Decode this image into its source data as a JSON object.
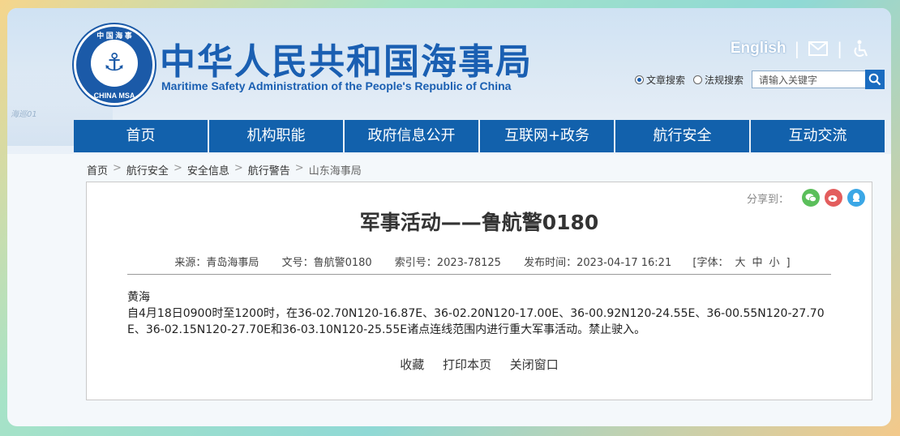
{
  "site": {
    "title_cn": "中华人民共和国海事局",
    "title_en": "Maritime Safety Administration of the People's Republic of China",
    "logo_top": "中 国 海 事",
    "logo_bottom": "CHINA MSA",
    "logo_symbol": "⚓",
    "ship_text": "海巡01"
  },
  "topbar": {
    "english_label": "English",
    "separator": "|",
    "mail_icon": "mail-icon",
    "accessibility_icon": "accessibility-icon"
  },
  "search": {
    "option_article": "文章搜索",
    "option_law": "法规搜索",
    "selected": "文章搜索",
    "placeholder": "请输入关键字"
  },
  "nav": {
    "items": [
      "首页",
      "机构职能",
      "政府信息公开",
      "互联网+政务",
      "航行安全",
      "互动交流"
    ]
  },
  "breadcrumb": {
    "items": [
      "首页",
      "航行安全",
      "安全信息",
      "航行警告",
      "山东海事局"
    ],
    "separator": ">"
  },
  "share": {
    "label": "分享到：",
    "icons": [
      "wechat-icon",
      "weibo-icon",
      "qq-icon"
    ],
    "colors": [
      "#5bbf5b",
      "#e35d5d",
      "#3ba7e6"
    ]
  },
  "article": {
    "title": "军事活动——鲁航警0180",
    "source": "来源：青岛海事局",
    "doc_no": "文号：鲁航警0180",
    "index_no": "索引号：2023-78125",
    "publish_time": "发布时间：2023-04-17 16:21",
    "font_label": "[字体：",
    "font_large": "大",
    "font_medium": "中",
    "font_small": "小",
    "font_end": "]",
    "area": "黄海",
    "content": "自4月18日0900时至1200时，在36-02.70N120-16.87E、36-02.20N120-17.00E、36-00.92N120-24.55E、36-00.55N120-27.70E、36-02.15N120-27.70E和36-03.10N120-25.55E诸点连线范围内进行重大军事活动。禁止驶入。"
  },
  "actions": {
    "favorite": "收藏",
    "print": "打印本页",
    "close": "关闭窗口"
  },
  "colors": {
    "brand": "#1a5fb2",
    "nav_bg": "#1261ac"
  }
}
